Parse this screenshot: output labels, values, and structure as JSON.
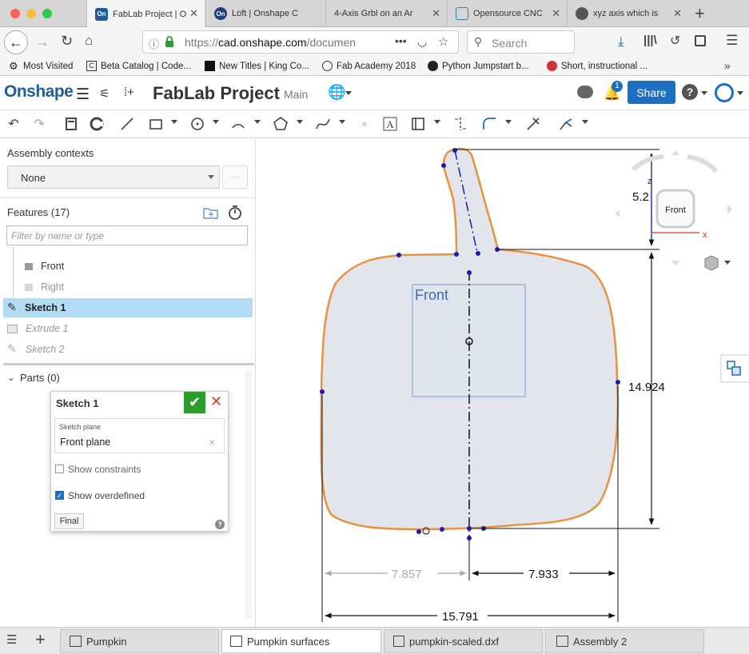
{
  "browser": {
    "tabs": [
      {
        "title": "FabLab Project | O",
        "favicon": "On",
        "active": true
      },
      {
        "title": "Loft | Onshape C",
        "favicon": "On",
        "active": false
      },
      {
        "title": "4-Axis Grbl on an Ar",
        "favicon": "",
        "active": false
      },
      {
        "title": "Opensource CNC",
        "favicon": "",
        "active": false
      },
      {
        "title": "xyz axis which is",
        "favicon": "",
        "active": false
      }
    ],
    "url": "https://cad.onshape.com/documen",
    "url_host": "cad.onshape.com",
    "url_prefix": "https://",
    "url_suffix": "/documen",
    "search_placeholder": "Search",
    "bookmarks": [
      "Most Visited",
      "Beta Catalog | Code...",
      "New Titles | King Co...",
      "Fab Academy 2018",
      "Python Jumpstart b...",
      "Short, instructional ..."
    ]
  },
  "app": {
    "logo": "Onshape",
    "doc_title": "FabLab Project",
    "branch": "Main",
    "share_label": "Share",
    "notification_count": "1",
    "help_label": "?"
  },
  "left_panel": {
    "assembly_contexts_label": "Assembly contexts",
    "assembly_context_value": "None",
    "features_label": "Features (17)",
    "filter_placeholder": "Filter by name or type",
    "features": [
      {
        "name": "Front",
        "type": "plane",
        "state": "normal"
      },
      {
        "name": "Right",
        "type": "plane",
        "state": "muted"
      },
      {
        "name": "Sketch 1",
        "type": "sketch",
        "state": "selected"
      },
      {
        "name": "Extrude 1",
        "type": "extrude",
        "state": "rolled"
      },
      {
        "name": "Sketch 2",
        "type": "sketch",
        "state": "rolled"
      }
    ],
    "parts_label": "Parts (0)"
  },
  "sketch_dialog": {
    "title": "Sketch 1",
    "plane_label": "Sketch plane",
    "plane_value": "Front plane",
    "show_constraints_label": "Show constraints",
    "show_constraints_checked": false,
    "show_overdefined_label": "Show overdefined",
    "show_overdefined_checked": true,
    "final_label": "Final"
  },
  "canvas": {
    "plane_label": "Front",
    "view_cube_label": "Front",
    "axis_z": "z",
    "axis_x": "x",
    "dimensions": {
      "stem_height": "5.2",
      "body_height": "14.924",
      "left_width": "7.857",
      "right_width": "7.933",
      "total_width": "15.791"
    }
  },
  "bottom_tabs": [
    {
      "label": "Pumpkin",
      "active": false
    },
    {
      "label": "Pumpkin surfaces",
      "active": true
    },
    {
      "label": "pumpkin-scaled.dxf",
      "active": false
    },
    {
      "label": "Assembly 2",
      "active": false
    }
  ],
  "colors": {
    "onshape_blue": "#1f5d9e",
    "share_button": "#1e6fc2",
    "sketch_orange": "#e8923f",
    "sketch_blue": "#1c1cb0",
    "selected_row": "#b2dcf3",
    "confirm_green": "#2a9d2a"
  }
}
